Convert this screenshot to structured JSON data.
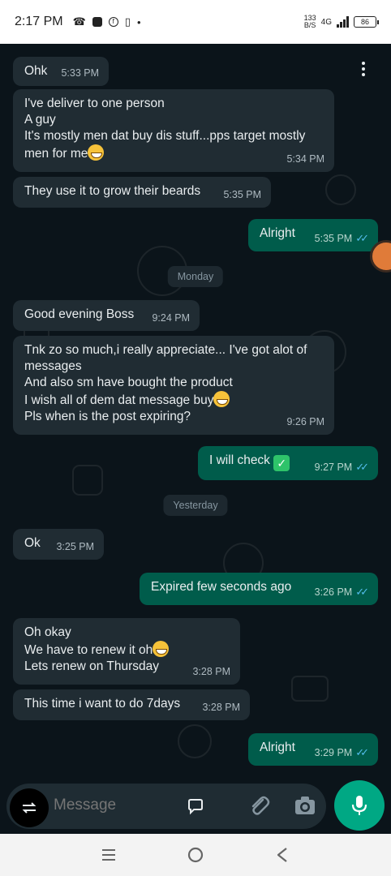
{
  "status_bar": {
    "time": "2:17 PM",
    "net_speed_value": "133",
    "net_speed_unit": "B/S",
    "network_type": "4G",
    "battery": "86"
  },
  "messages": [
    {
      "dir": "in",
      "lines": [
        "Ohk"
      ],
      "time": "5:33 PM"
    },
    {
      "dir": "in",
      "lines": [
        "I've deliver to one person",
        "A guy",
        "It's mostly men dat buy dis stuff...pps target mostly",
        "men for me"
      ],
      "time": "5:34 PM"
    },
    {
      "dir": "in",
      "lines": [
        "They use it to grow their beards"
      ],
      "time": "5:35 PM"
    },
    {
      "dir": "out",
      "lines": [
        "Alright"
      ],
      "time": "5:35 PM"
    },
    {
      "dir": "in",
      "lines": [
        "Good evening Boss"
      ],
      "time": "9:24 PM"
    },
    {
      "dir": "in",
      "lines": [
        "Tnk zo so much,i really appreciate... I've got alot of",
        "messages",
        "And also sm have bought the product",
        "I wish all of dem dat message buy",
        "Pls when is the post expiring?"
      ],
      "time": "9:26 PM"
    },
    {
      "dir": "out",
      "lines": [
        "I will check"
      ],
      "time": "9:27 PM"
    },
    {
      "dir": "in",
      "lines": [
        "Ok"
      ],
      "time": "3:25 PM"
    },
    {
      "dir": "out",
      "lines": [
        "Expired few seconds ago"
      ],
      "time": "3:26 PM"
    },
    {
      "dir": "in",
      "lines": [
        "Oh okay",
        "We have to renew it oh",
        "Lets renew on Thursday"
      ],
      "time": "3:28 PM"
    },
    {
      "dir": "in",
      "lines": [
        "This time i want to do 7days"
      ],
      "time": "3:28 PM"
    },
    {
      "dir": "out",
      "lines": [
        "Alright"
      ],
      "time": "3:29 PM"
    }
  ],
  "date_chips": [
    "Monday",
    "Yesterday"
  ],
  "input": {
    "placeholder": "Message"
  },
  "icons": [
    "menu-dots-icon",
    "sticker-icon",
    "attach-icon",
    "camera-icon",
    "mic-icon",
    "recent-apps-icon",
    "home-icon",
    "back-icon"
  ],
  "colors": {
    "background": "#0b141a",
    "incoming_bubble": "#202c33",
    "outgoing_bubble": "#005c4b",
    "read_ticks": "#53bdeb",
    "mic_button": "#00a884"
  }
}
